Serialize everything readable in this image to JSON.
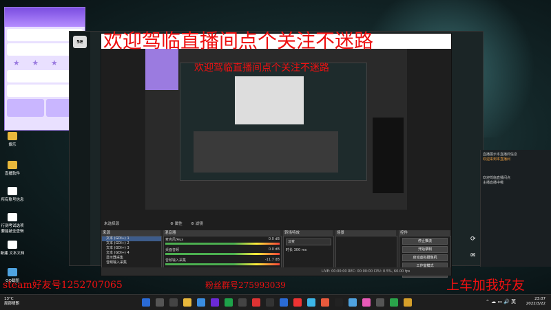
{
  "overlay": {
    "welcome_top": "欢迎驾临直播间点个关注不迷路",
    "welcome_mid": "欢迎驾临直播间点个关注不迷路",
    "steam_friend": "steam好友号1252707065",
    "fan_group": "粉丝群号275993039",
    "add_friend": "上车加我好友"
  },
  "desktop": {
    "icons": [
      {
        "label": "娱乐"
      },
      {
        "label": "直播软件"
      },
      {
        "label": "所有账号信息"
      },
      {
        "label": "行测考试选项 要能被全查辑"
      },
      {
        "label": "新建 文本文档"
      },
      {
        "label": "QQ截图"
      }
    ]
  },
  "dark_app": {
    "logo": "5E"
  },
  "right_panel": {
    "lines": [
      "直播展示本直播间信息",
      "欢迎来到本直播间",
      "欢迎驾临直播间点",
      "主播直播中哦"
    ]
  },
  "obs": {
    "scene_label": "未选择源",
    "props_label": "属性",
    "filter_label": "滤镜",
    "panels": {
      "sources": "来源",
      "mixer": "混音器",
      "transitions": "转场特效",
      "scenes": "场景",
      "controls": "控件"
    },
    "sources": [
      "文本 (GDI+) 1",
      "文本 (GDI+) 2",
      "文本 (GDI+) 3",
      "文本 (GDI+) 4",
      "显示器采集",
      "音频输入采集",
      "视频采集设备"
    ],
    "mixer": [
      {
        "name": "麦克风/Aux",
        "db": "0.0 dB"
      },
      {
        "name": "桌面音频",
        "db": "0.0 dB"
      },
      {
        "name": "音频输入采集",
        "db": "-11.7 dB"
      }
    ],
    "transition": {
      "type": "淡变",
      "duration_label": "时长",
      "duration": "300 ms"
    },
    "controls": [
      "停止推流",
      "开始录制",
      "启动虚拟摄像机",
      "工作室模式",
      "设置",
      "退出"
    ],
    "status": "LIVE: 00:00:00    REC: 00:00:00    CPU: 0.5%, 60.00 fps"
  },
  "taskbar": {
    "weather_temp": "13°C",
    "weather_desc": "局部晴朗",
    "lang": "英",
    "time": "23:07",
    "date": "2022/3/22"
  }
}
